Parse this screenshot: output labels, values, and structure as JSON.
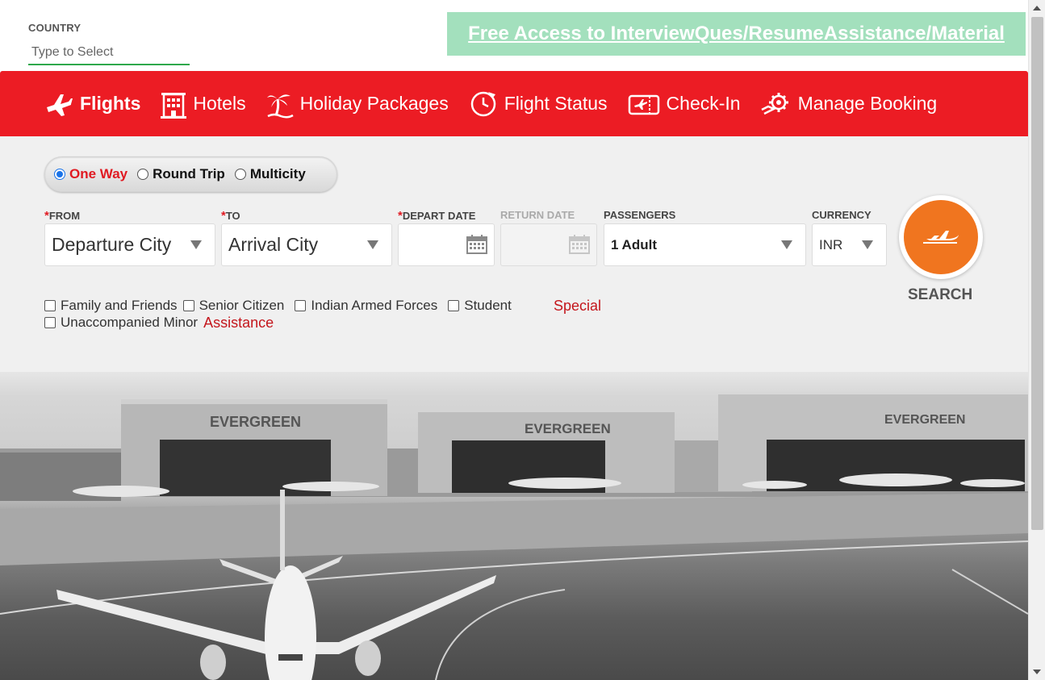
{
  "country": {
    "label": "COUNTRY",
    "placeholder": "Type to Select"
  },
  "promo": {
    "text": "Free Access to InterviewQues/ResumeAssistance/Material"
  },
  "nav": {
    "items": [
      {
        "label": "Flights",
        "icon": "airplane-icon"
      },
      {
        "label": "Hotels",
        "icon": "hotel-building-icon"
      },
      {
        "label": "Holiday Packages",
        "icon": "palm-tree-icon"
      },
      {
        "label": "Flight Status",
        "icon": "clock-plane-icon"
      },
      {
        "label": "Check-In",
        "icon": "boarding-pass-icon"
      },
      {
        "label": "Manage Booking",
        "icon": "gear-hand-icon"
      }
    ]
  },
  "trip": {
    "one_way": "One Way",
    "round_trip": "Round Trip",
    "multicity": "Multicity"
  },
  "form": {
    "from_label": "FROM",
    "from_value": "Departure City",
    "to_label": "TO",
    "to_value": "Arrival City",
    "depart_label": "DEPART DATE",
    "return_label": "RETURN DATE",
    "passengers_label": "PASSENGERS",
    "passengers_value": "1 Adult",
    "currency_label": "CURRENCY",
    "currency_value": "INR",
    "search_label": "SEARCH"
  },
  "options": {
    "family": "Family and Friends",
    "senior": "Senior Citizen",
    "armed": "Indian Armed Forces",
    "student": "Student",
    "minor": "Unaccompanied Minor",
    "special": "Special",
    "assistance": "Assistance"
  },
  "hero": {
    "hangar_sign": "EVERGREEN"
  },
  "colors": {
    "brand_red": "#ec1c24",
    "search_orange": "#f0751f",
    "promo_green": "#a3e0bd"
  }
}
